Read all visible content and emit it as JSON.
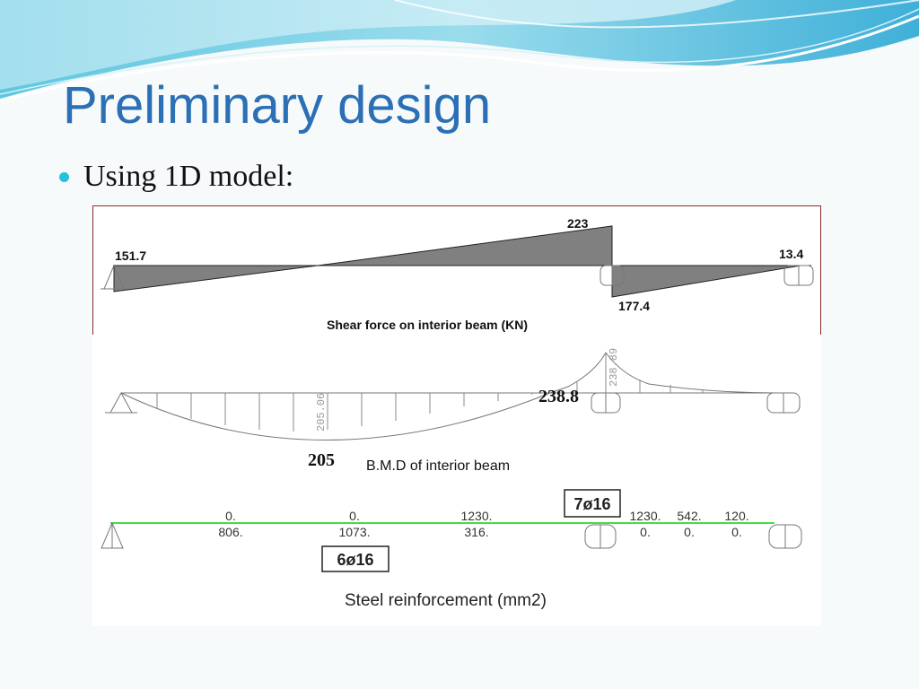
{
  "slide": {
    "title": "Preliminary design",
    "bullet": "Using 1D model:"
  },
  "shear": {
    "caption": "Shear force on interior beam (KN)",
    "left_value": "151.7",
    "peak_value": "223",
    "drop_value": "177.4",
    "right_value": "13.4"
  },
  "bmd": {
    "caption": "B.M.D of interior beam",
    "sag_value_rot": "205.06",
    "hog_value_rot": "238.89",
    "sag_label": "205",
    "hog_label": "238.8"
  },
  "steel": {
    "caption": "Steel reinforcement (mm2)",
    "top_bar_label": "7ø16",
    "bottom_bar_label": "6ø16",
    "columns": [
      {
        "top": "0.",
        "bottom": "806."
      },
      {
        "top": "0.",
        "bottom": "1073."
      },
      {
        "top": "1230.",
        "bottom": "316."
      },
      {
        "top": "1230.",
        "bottom": "0."
      },
      {
        "top": "542.",
        "bottom": "0."
      },
      {
        "top": "120.",
        "bottom": "0."
      }
    ]
  },
  "colors": {
    "title": "#2b6fb5",
    "bullet": "#27bfe0",
    "shear_fill": "#808080",
    "rebar_line": "#44dd44"
  }
}
